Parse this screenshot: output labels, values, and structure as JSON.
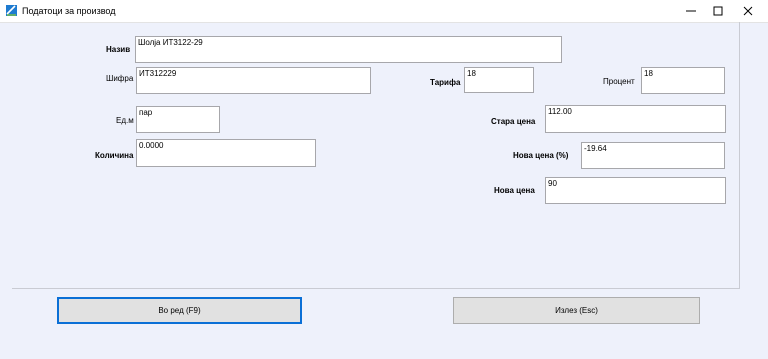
{
  "window": {
    "title": "Податоци за производ",
    "controls": [
      "minimize",
      "maximize",
      "close"
    ]
  },
  "form": {
    "naziv": {
      "label": "Назив",
      "value": "Шолја ИТ3122-29"
    },
    "shifra": {
      "label": "Шифра",
      "value": "ИТ312229"
    },
    "tarifa": {
      "label": "Тарифа",
      "value": "18"
    },
    "procent": {
      "label": "Процент",
      "value": "18"
    },
    "edm": {
      "label": "Ед.м",
      "value": "пар"
    },
    "stara_cena": {
      "label": "Стара цена",
      "value": "112.00"
    },
    "kolicina": {
      "label": "Количина",
      "value": "0.0000"
    },
    "nova_cena_pct": {
      "label": "Нова цена (%)",
      "value": "-19.64"
    },
    "nova_cena": {
      "label": "Нова цена",
      "value": "90"
    }
  },
  "buttons": {
    "vo_red": "Во ред (F9)",
    "izlez": "Излез (Esc)"
  },
  "colors": {
    "background": "#eef1fb",
    "focus_border": "#0a6fd6",
    "button_face": "#e1e1e1"
  }
}
